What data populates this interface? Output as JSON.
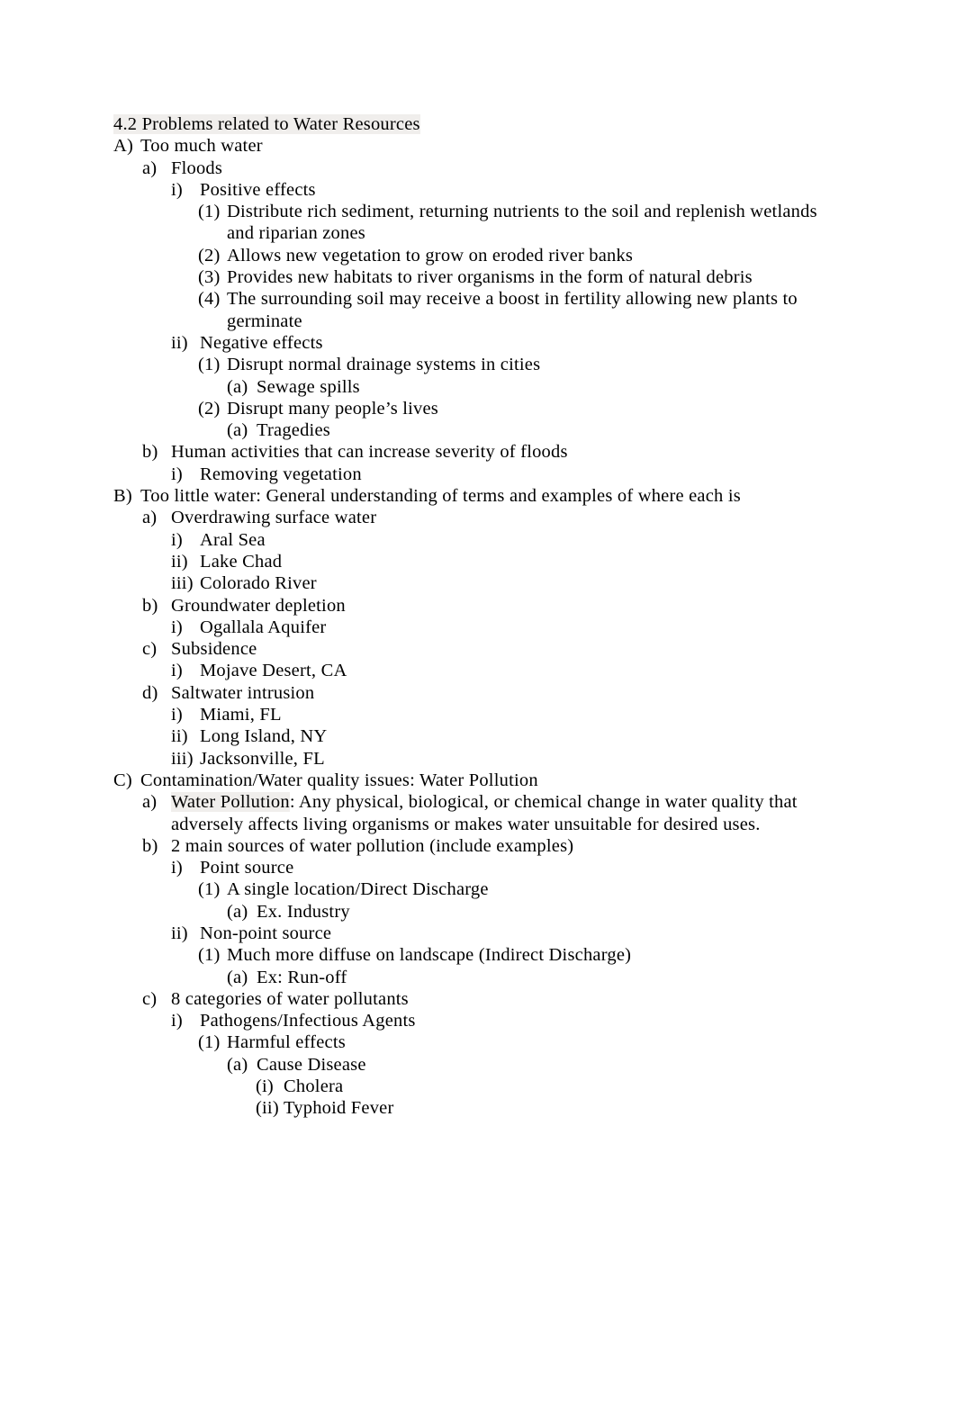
{
  "document": {
    "heading": "4.2 Problems related to Water Resources",
    "highlight_color": "#f0eeec",
    "text_color": "#000000",
    "background_color": "#ffffff"
  },
  "outline": [
    {
      "level": 1,
      "marker": "",
      "text": "4.2 Problems related to Water Resources",
      "heading": true,
      "highlight": true
    },
    {
      "level": 1,
      "marker": "A)",
      "text": "Too much water"
    },
    {
      "level": 2,
      "marker": "a)",
      "text": "Floods"
    },
    {
      "level": 3,
      "marker": "i)",
      "text": "Positive effects"
    },
    {
      "level": 4,
      "marker": "(1)",
      "text": "Distribute rich sediment, returning nutrients to the soil and replenish wetlands and riparian zones"
    },
    {
      "level": 4,
      "marker": "(2)",
      "text": "Allows new vegetation to grow on eroded river banks"
    },
    {
      "level": 4,
      "marker": "(3)",
      "text": "Provides new habitats to river organisms in the form of natural debris"
    },
    {
      "level": 4,
      "marker": "(4)",
      "text": "The surrounding soil may receive a boost in fertility allowing new plants to germinate"
    },
    {
      "level": 3,
      "marker": "ii)",
      "text": "Negative effects"
    },
    {
      "level": 4,
      "marker": "(1)",
      "text": "Disrupt normal drainage systems in cities"
    },
    {
      "level": 5,
      "marker": "(a)",
      "text": "Sewage spills"
    },
    {
      "level": 4,
      "marker": "(2)",
      "text": "Disrupt many people’s lives"
    },
    {
      "level": 5,
      "marker": "(a)",
      "text": "Tragedies"
    },
    {
      "level": 2,
      "marker": "b)",
      "text": "Human activities that can increase severity of floods"
    },
    {
      "level": 3,
      "marker": "i)",
      "text": "Removing vegetation"
    },
    {
      "level": 1,
      "marker": "B)",
      "text": "Too little water: General understanding of terms and examples of where each is"
    },
    {
      "level": 2,
      "marker": "a)",
      "text": "Overdrawing surface water"
    },
    {
      "level": 3,
      "marker": "i)",
      "text": "Aral Sea"
    },
    {
      "level": 3,
      "marker": "ii)",
      "text": "Lake Chad"
    },
    {
      "level": 3,
      "marker": "iii)",
      "text": "Colorado River"
    },
    {
      "level": 2,
      "marker": "b)",
      "text": "Groundwater depletion"
    },
    {
      "level": 3,
      "marker": "i)",
      "text": "Ogallala Aquifer"
    },
    {
      "level": 2,
      "marker": "c)",
      "text": "Subsidence"
    },
    {
      "level": 3,
      "marker": "i)",
      "text": "Mojave Desert, CA"
    },
    {
      "level": 2,
      "marker": "d)",
      "text": "Saltwater intrusion"
    },
    {
      "level": 3,
      "marker": "i)",
      "text": "Miami, FL"
    },
    {
      "level": 3,
      "marker": "ii)",
      "text": "Long Island, NY"
    },
    {
      "level": 3,
      "marker": "iii)",
      "text": "Jacksonville, FL"
    },
    {
      "level": 1,
      "marker": "C)",
      "text": "Contamination/Water quality issues: Water Pollution"
    },
    {
      "level": 2,
      "marker": "a)",
      "text": "Water Pollution: Any physical, biological, or chemical change in water quality that adversely affects living organisms or makes water unsuitable for desired uses.",
      "highlight_span": "Water Pollution"
    },
    {
      "level": 2,
      "marker": "b)",
      "text": "2 main sources of water pollution (include examples)"
    },
    {
      "level": 3,
      "marker": "i)",
      "text": "Point source"
    },
    {
      "level": 4,
      "marker": "(1)",
      "text": "A single location/Direct Discharge"
    },
    {
      "level": 5,
      "marker": "(a)",
      "text": "Ex. Industry"
    },
    {
      "level": 3,
      "marker": "ii)",
      "text": "Non-point source"
    },
    {
      "level": 4,
      "marker": "(1)",
      "text": "Much more diffuse on landscape (Indirect Discharge)"
    },
    {
      "level": 5,
      "marker": "(a)",
      "text": "Ex: Run-off"
    },
    {
      "level": 2,
      "marker": "c)",
      "text": "8 categories of water pollutants"
    },
    {
      "level": 3,
      "marker": "i)",
      "text": "Pathogens/Infectious Agents"
    },
    {
      "level": 4,
      "marker": "(1)",
      "text": "Harmful effects"
    },
    {
      "level": 5,
      "marker": "(a)",
      "text": "Cause Disease"
    },
    {
      "level": 6,
      "marker": "(i)",
      "text": "Cholera"
    },
    {
      "level": 6,
      "marker": "(ii)",
      "text": "Typhoid Fever"
    }
  ]
}
